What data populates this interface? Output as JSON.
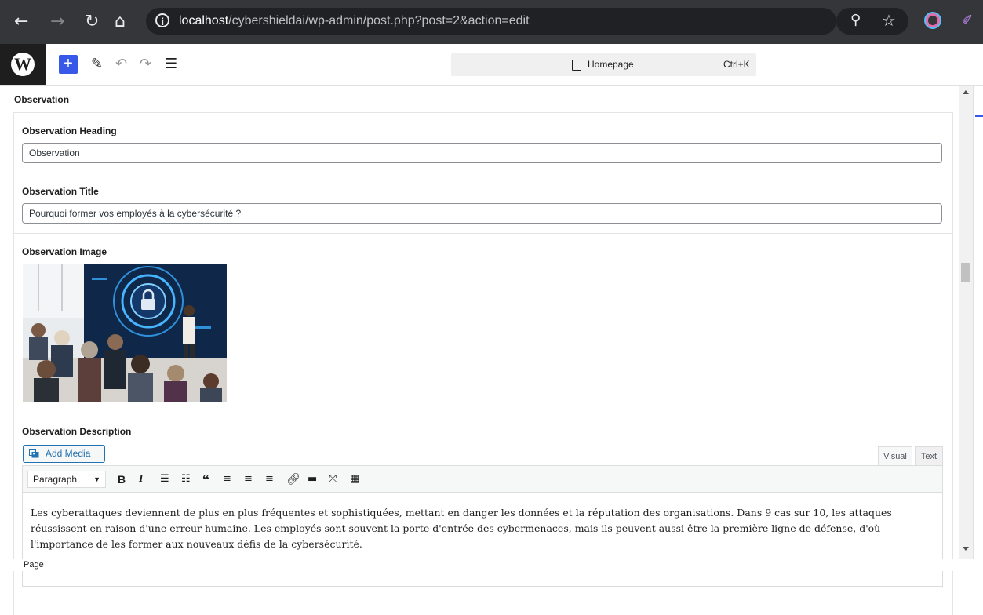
{
  "browser": {
    "url_host": "localhost",
    "url_path": "/cybershieldai/wp-admin/post.php?post=2&action=edit",
    "icons": [
      "back-icon",
      "forward-icon",
      "reload-icon",
      "home-icon",
      "site-info-icon",
      "zoom-icon",
      "bookmark-star-icon",
      "extension-icon",
      "pen-extension-icon"
    ]
  },
  "wp_toolbar": {
    "document_title": "Homepage",
    "shortcut": "Ctrl+K",
    "accent_color": "#3858e9"
  },
  "section": {
    "title": "Observation",
    "heading_label": "Observation Heading",
    "heading_value": "Observation",
    "title_label": "Observation Title",
    "title_value": "Pourquoi former vos employés à la cybersécurité ?",
    "image_label": "Observation Image",
    "description_label": "Observation Description"
  },
  "editor": {
    "add_media": "Add Media",
    "tab_visual": "Visual",
    "tab_text": "Text",
    "format_select": "Paragraph",
    "bold": "B",
    "italic": "I",
    "content": "Les cyberattaques deviennent de plus en plus fréquentes et sophistiquées, mettant en danger les données et la réputation des organisations. Dans 9 cas sur 10, les attaques réussissent en raison d'une erreur humaine. Les employés sont souvent la porte d'entrée des cybermenaces, mais ils peuvent aussi être la première ligne de défense, d'où l'importance de les former aux nouveaux défis de la cybersécurité."
  },
  "footer": {
    "breadcrumb": "Page"
  }
}
